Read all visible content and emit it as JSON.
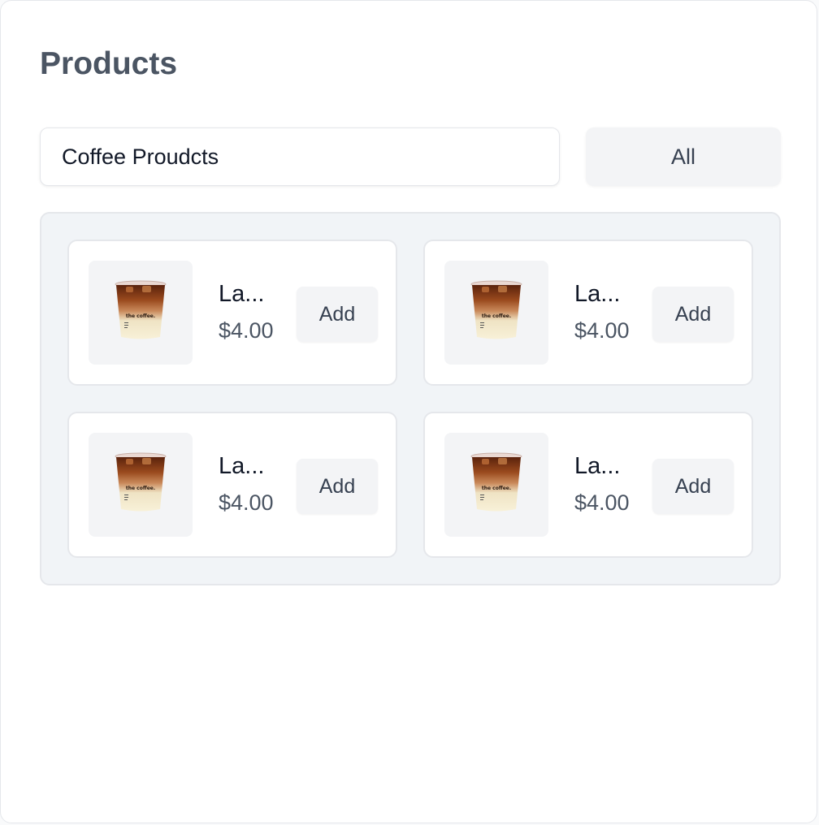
{
  "header": {
    "title": "Products"
  },
  "search": {
    "value": "Coffee Proudcts"
  },
  "filter": {
    "label": "All"
  },
  "products": [
    {
      "name": "La...",
      "price": "$4.00",
      "add_label": "Add",
      "image_icon": "iced-latte-cup-icon",
      "cup_text": "the coffee."
    },
    {
      "name": "La...",
      "price": "$4.00",
      "add_label": "Add",
      "image_icon": "iced-latte-cup-icon",
      "cup_text": "the coffee."
    },
    {
      "name": "La...",
      "price": "$4.00",
      "add_label": "Add",
      "image_icon": "iced-latte-cup-icon",
      "cup_text": "the coffee."
    },
    {
      "name": "La...",
      "price": "$4.00",
      "add_label": "Add",
      "image_icon": "iced-latte-cup-icon",
      "cup_text": "the coffee."
    }
  ],
  "colors": {
    "title": "#4b5563",
    "grid_background": "#f1f4f7",
    "button_background": "#f3f4f6",
    "border": "#e5e7eb"
  }
}
